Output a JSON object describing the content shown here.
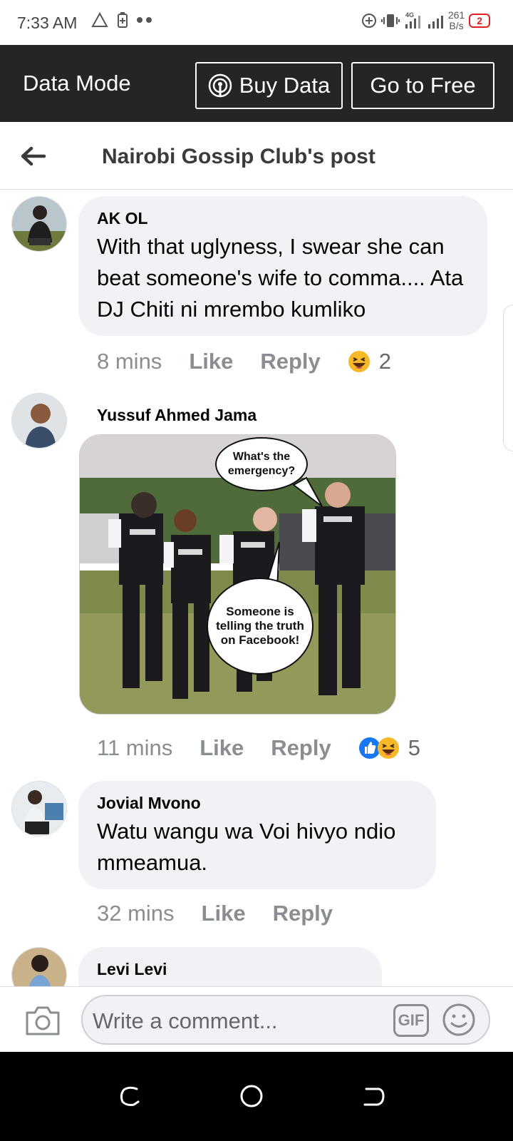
{
  "status_bar": {
    "time": "7:33 AM",
    "network": "4G",
    "speed_value": "261",
    "speed_unit": "B/s",
    "notification_count": "2"
  },
  "data_mode": {
    "title": "Data Mode",
    "buy_data_label": "Buy Data",
    "free_label": "Go to Free"
  },
  "header": {
    "title": "Nairobi Gossip Club's post"
  },
  "comments": [
    {
      "author": "AK OL",
      "text": "With that uglyness, I swear she can beat someone's wife to comma.... Ata DJ Chiti ni mrembo kumliko",
      "time": "8 mins",
      "like": "Like",
      "reply": "Reply",
      "reactions": [
        "haha-icon"
      ],
      "reaction_count": "2"
    },
    {
      "author": "Yussuf Ahmed Jama",
      "image": {
        "bubble_top": "What's the emergency?",
        "bubble_bottom": "Someone is telling the truth on Facebook!",
        "vest_text": "POLICE"
      },
      "time": "11 mins",
      "like": "Like",
      "reply": "Reply",
      "reactions": [
        "like-icon",
        "haha-icon"
      ],
      "reaction_count": "5"
    },
    {
      "author": "Jovial Mvono",
      "text": "Watu wangu wa Voi hivyo ndio mmeamua.",
      "time": "32 mins",
      "like": "Like",
      "reply": "Reply"
    },
    {
      "author": "Levi Levi"
    }
  ],
  "composer": {
    "placeholder": "Write a comment...",
    "gif_label": "GIF"
  },
  "colors": {
    "data_bar_bg": "#242526",
    "bubble_bg": "#f0f2f5",
    "meta_text": "#8a8d91",
    "like_blue": "#1877f2",
    "haha_yellow": "#f7b928"
  }
}
